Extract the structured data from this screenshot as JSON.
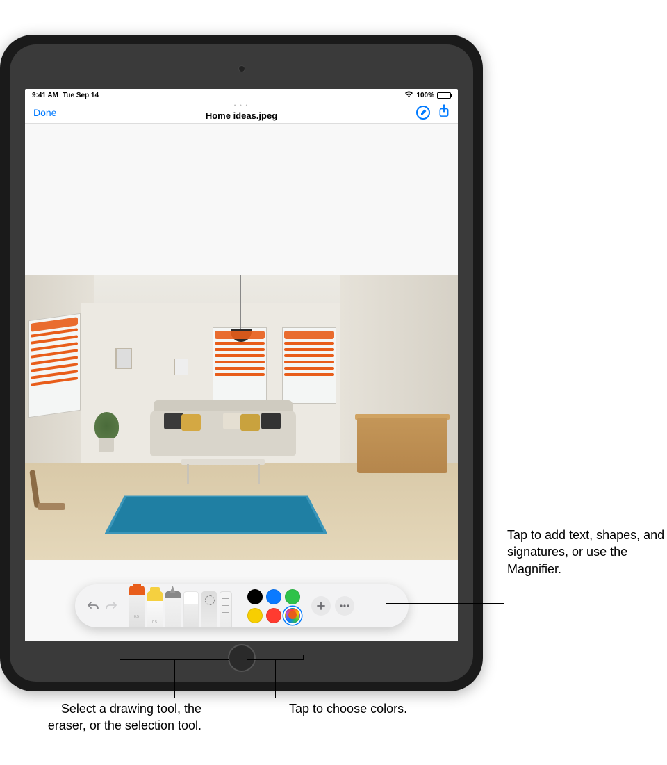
{
  "status_bar": {
    "time": "9:41 AM",
    "date": "Tue Sep 14",
    "battery_percent": "100%"
  },
  "nav": {
    "done_label": "Done",
    "title": "Home ideas.jpeg"
  },
  "toolbar": {
    "tools": [
      {
        "name": "pen",
        "selected": true
      },
      {
        "name": "marker",
        "selected": false
      },
      {
        "name": "pencil",
        "selected": false
      },
      {
        "name": "eraser",
        "selected": false
      },
      {
        "name": "lasso",
        "selected": false
      },
      {
        "name": "ruler",
        "selected": false
      }
    ],
    "colors": [
      {
        "hex": "#000000",
        "selected": false
      },
      {
        "hex": "#0a7aff",
        "selected": false
      },
      {
        "hex": "#2fc24a",
        "selected": false
      },
      {
        "hex": "#f7ce02",
        "selected": false
      },
      {
        "hex": "#ff3b30",
        "selected": false
      },
      {
        "hex": "#e85d1a",
        "selected": true,
        "multicolor": true
      }
    ]
  },
  "callouts": {
    "add_text": "Tap to add text, shapes, and signatures, or use the Magnifier.",
    "drawing_tools": "Select a drawing tool, the eraser, or the selection tool.",
    "choose_colors": "Tap to choose colors."
  }
}
